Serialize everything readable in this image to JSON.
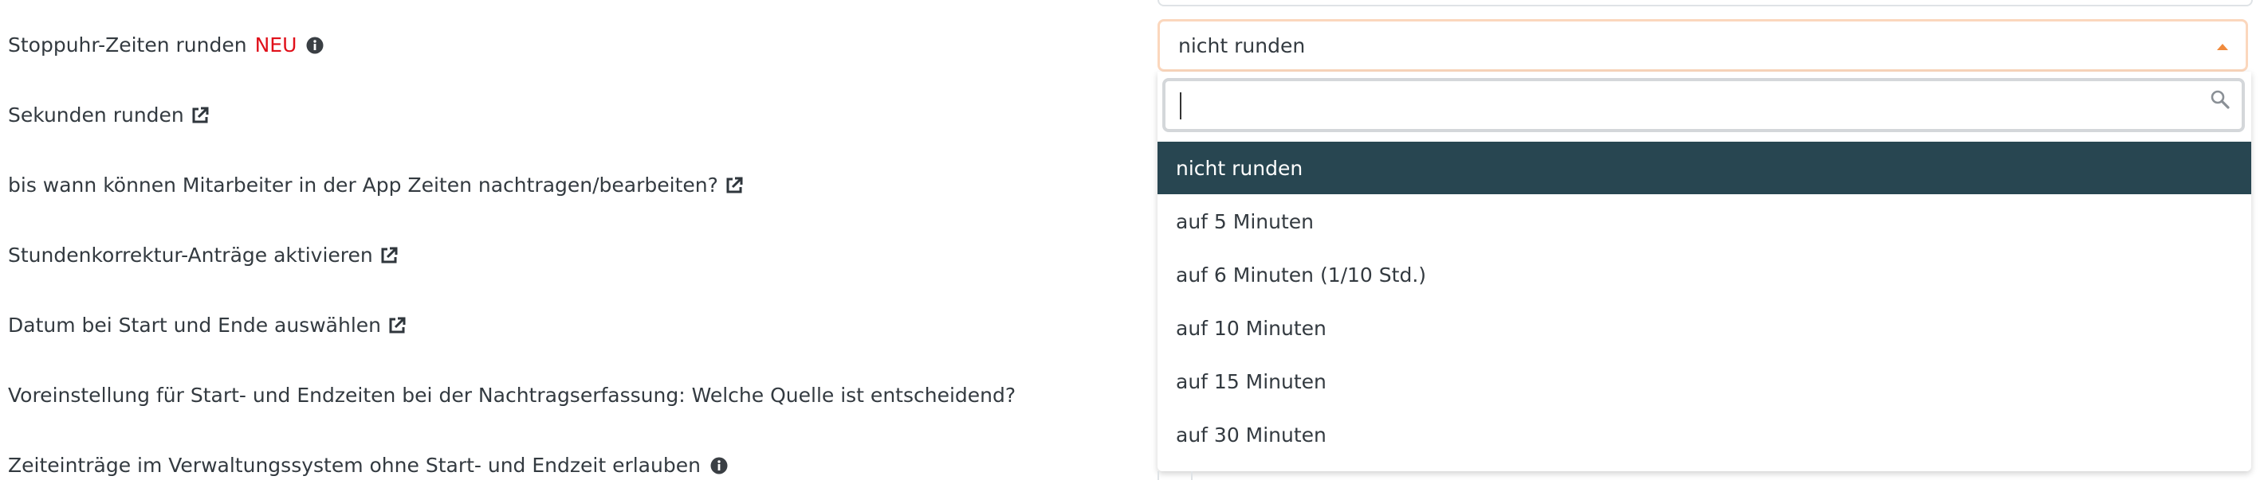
{
  "settings": {
    "stopwatch_label": "Stoppuhr-Zeiten runden",
    "stopwatch_badge": "NEU",
    "round_seconds_label": "Sekunden runden",
    "edit_deadline_label": "bis wann können Mitarbeiter in der App Zeiten nachtragen/bearbeiten?",
    "correction_requests_label": "Stundenkorrektur-Anträge aktivieren",
    "date_start_end_label": "Datum bei Start und Ende auswählen",
    "default_source_label": "Voreinstellung für Start- und Endzeiten bei der Nachtragserfassung: Welche Quelle ist entscheidend?",
    "no_start_end_label": "Zeiteinträge im Verwaltungssystem ohne Start- und Endzeit erlauben"
  },
  "select": {
    "value": "nicht runden",
    "search_value": "",
    "options": [
      "nicht runden",
      "auf 5 Minuten",
      "auf 6 Minuten (1/10 Std.)",
      "auf 10 Minuten",
      "auf 15 Minuten",
      "auf 30 Minuten"
    ],
    "selected_index": 0
  },
  "colors": {
    "badge": "#e0101a",
    "selected_option_bg": "#284651",
    "focus_border": "#fbd7bd",
    "arrow": "#f08a3c"
  },
  "icons": {
    "info": "info-icon",
    "external": "external-link-icon",
    "search": "search-icon",
    "arrow": "caret-up-icon"
  }
}
